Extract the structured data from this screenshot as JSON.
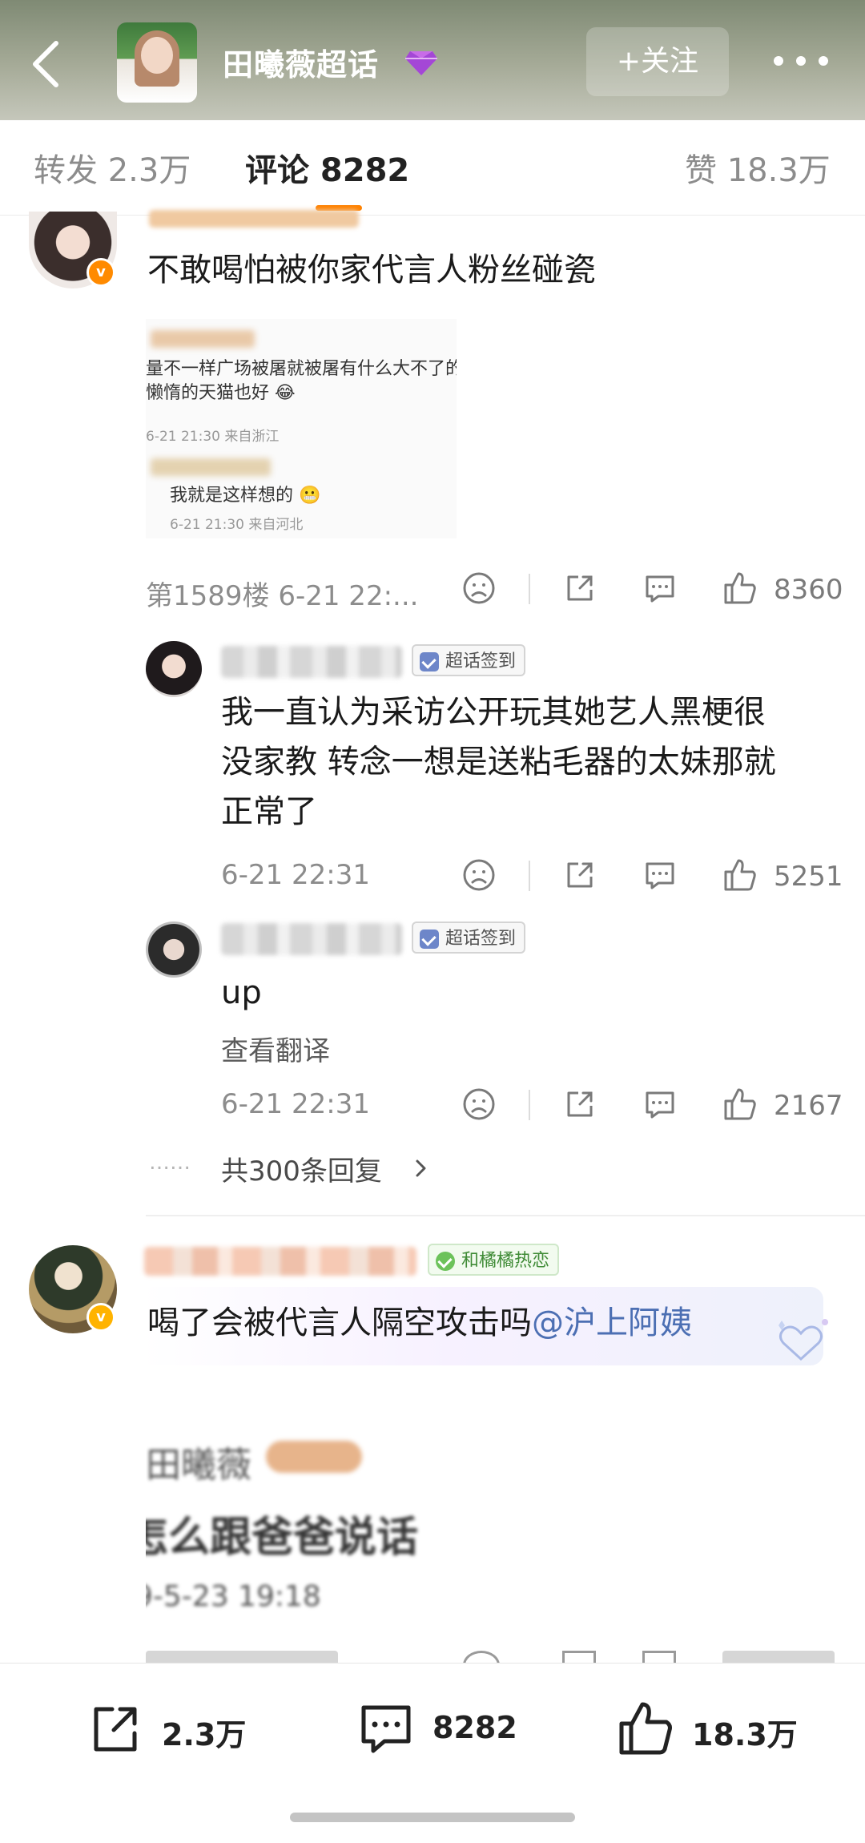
{
  "header": {
    "title": "田曦薇超话",
    "follow_label": "+关注"
  },
  "tabs": {
    "repost": "转发 2.3万",
    "comments": "评论 8282",
    "likes": "赞 18.3万"
  },
  "comments": [
    {
      "text": "不敢喝怕被你家代言人粉丝碰瓷",
      "quote_lines": [
        "量不一样广场被屠就被屠有什么大不了的,",
        "懒惰的天猫也好 😂",
        "6-21 21:30 来自浙江",
        "我就是这样想的 😬",
        "6-21 21:30 来自河北"
      ],
      "meta": "第1589楼 6-21 22:...",
      "likes": "8360"
    },
    {
      "tag": "超话签到",
      "text_lines": [
        "我一直认为采访公开玩其她艺人黑梗很",
        "没家教 转念一想是送粘毛器的太妹那就",
        "正常了"
      ],
      "time": "6-21 22:31",
      "likes": "5251"
    },
    {
      "tag": "超话签到",
      "text": "up",
      "translate": "查看翻译",
      "time": "6-21 22:31",
      "likes": "2167"
    },
    {
      "replies_link": "共300条回复",
      "replies_dots": "……"
    },
    {
      "tag": "和橘橘热恋",
      "text": "喝了会被代言人隔空攻击吗",
      "mention": "@沪上阿姨",
      "image_lines": [
        "田曦薇",
        "怎么跟爸爸说话",
        "9-5-23 19:18"
      ]
    }
  ],
  "bottom_bar": {
    "repost_count": "2.3万",
    "comment_count": "8282",
    "like_count": "18.3万"
  },
  "colors": {
    "accent": "#ff8200",
    "mention": "#4c6fb3",
    "header_green": "#8a937e"
  }
}
